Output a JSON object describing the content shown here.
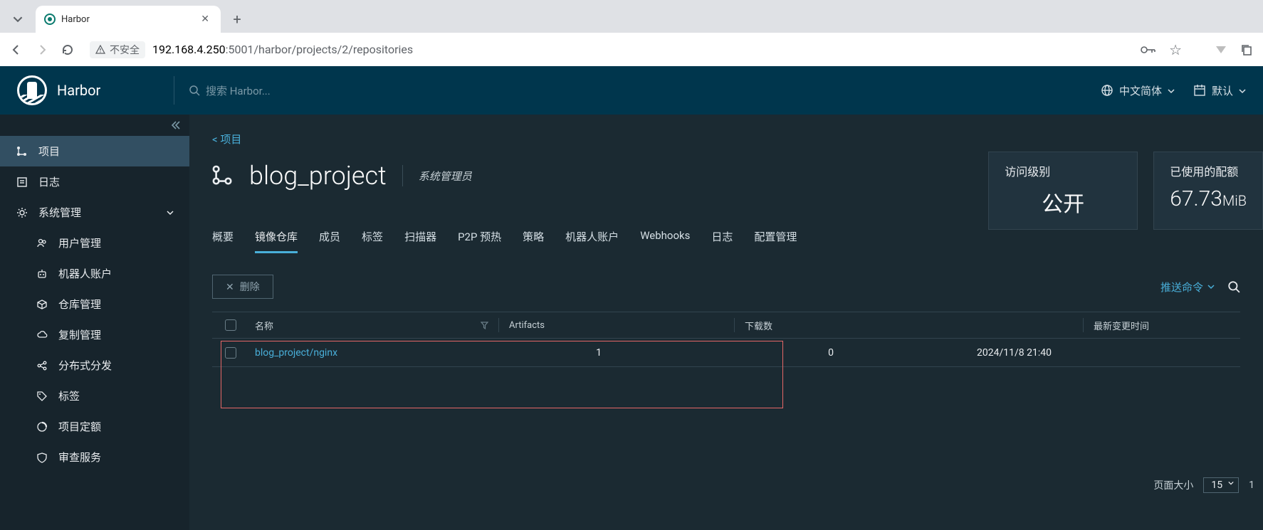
{
  "browser": {
    "tab_title": "Harbor",
    "insecure_label": "不安全",
    "url_host": "192.168.4.250",
    "url_port": ":5001",
    "url_path": "/harbor/projects/2/repositories"
  },
  "header": {
    "app_name": "Harbor",
    "search_placeholder": "搜索 Harbor...",
    "language": "中文简体",
    "theme": "默认"
  },
  "sidebar": {
    "items": [
      {
        "label": "项目"
      },
      {
        "label": "日志"
      },
      {
        "label": "系统管理"
      }
    ],
    "sub_items": [
      {
        "label": "用户管理"
      },
      {
        "label": "机器人账户"
      },
      {
        "label": "仓库管理"
      },
      {
        "label": "复制管理"
      },
      {
        "label": "分布式分发"
      },
      {
        "label": "标签"
      },
      {
        "label": "项目定额"
      },
      {
        "label": "审查服务"
      }
    ]
  },
  "main": {
    "breadcrumb": "< 项目",
    "project_name": "blog_project",
    "role": "系统管理员",
    "cards": {
      "access_level_label": "访问级别",
      "access_level_value": "公开",
      "quota_label": "已使用的配额",
      "quota_value": "67.73",
      "quota_unit": "MiB"
    },
    "tabs": [
      "概要",
      "镜像仓库",
      "成员",
      "标签",
      "扫描器",
      "P2P 预热",
      "策略",
      "机器人账户",
      "Webhooks",
      "日志",
      "配置管理"
    ],
    "active_tab": "镜像仓库",
    "delete_btn": "删除",
    "push_cmd": "推送命令",
    "table": {
      "cols": {
        "name": "名称",
        "artifacts": "Artifacts",
        "downloads": "下载数",
        "last_modified": "最新变更时间"
      },
      "rows": [
        {
          "name": "blog_project/nginx",
          "artifacts": "1",
          "downloads": "0",
          "last_modified": "2024/11/8 21:40"
        }
      ]
    },
    "pager": {
      "page_size_label": "页面大小",
      "page_size_value": "15",
      "total": "1"
    }
  }
}
